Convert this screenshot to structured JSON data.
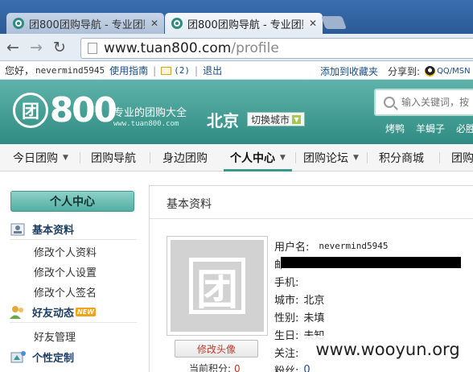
{
  "browser": {
    "tabs": [
      {
        "title": "团800团购导航 - 专业团购"
      },
      {
        "title": "团800团购导航 - 专业团购"
      }
    ],
    "url_host": "www.tuan800.com",
    "url_path": "/profile"
  },
  "topbar": {
    "greeting": "您好，",
    "username": "nevermind5945",
    "guide": "使用指南",
    "mail_count": "(2)",
    "logout": "退出",
    "bookmark": "添加到收藏夹",
    "share_label": "分享到:",
    "share_target": "QQ/MSN"
  },
  "header": {
    "logo_mark": "团",
    "logo_number": "800",
    "slogan": "专业的团购大全",
    "domain": "www.tuan800.com",
    "city": "北京",
    "switch_city": "切换城市",
    "search_placeholder": "输入关键词，按",
    "hot_keywords": [
      "烤鸭",
      "羊蝎子",
      "必胜"
    ]
  },
  "nav": {
    "items": [
      "今日团购",
      "团购导航",
      "身边团购",
      "个人中心",
      "团购论坛",
      "积分商城",
      "团购"
    ]
  },
  "sidebar": {
    "title": "个人中心",
    "basic_info": "基本资料",
    "edit_profile": "修改个人资料",
    "edit_settings": "修改个人设置",
    "edit_signature": "修改个人签名",
    "friends": "好友动态",
    "new_badge": "NEW",
    "friend_manage": "好友管理",
    "personalize": "个性定制"
  },
  "profile": {
    "panel_title": "基本资料",
    "avatar_glyph": "团",
    "change_avatar": "修改头像",
    "points_label": "当前积分:",
    "points_value": "0",
    "username_label": "用户名:",
    "username_value": "nevermind5945",
    "email_label": "邮",
    "phone_label": "手机:",
    "city_label": "城市:",
    "city_value": "北京",
    "gender_label": "性别:",
    "gender_value": "未填",
    "birthday_label": "生日:",
    "birthday_value": "未知",
    "follow_label": "关注:",
    "fans_label": "粉丝:",
    "fans_value": "0"
  },
  "watermark": "www.wooyun.org",
  "colors": {
    "brand_teal": "#3b9a8f",
    "header_top": "#5fb3aa",
    "header_bottom": "#2f8c82",
    "link_blue": "#1a4d88",
    "accent_red": "#c0392b"
  }
}
